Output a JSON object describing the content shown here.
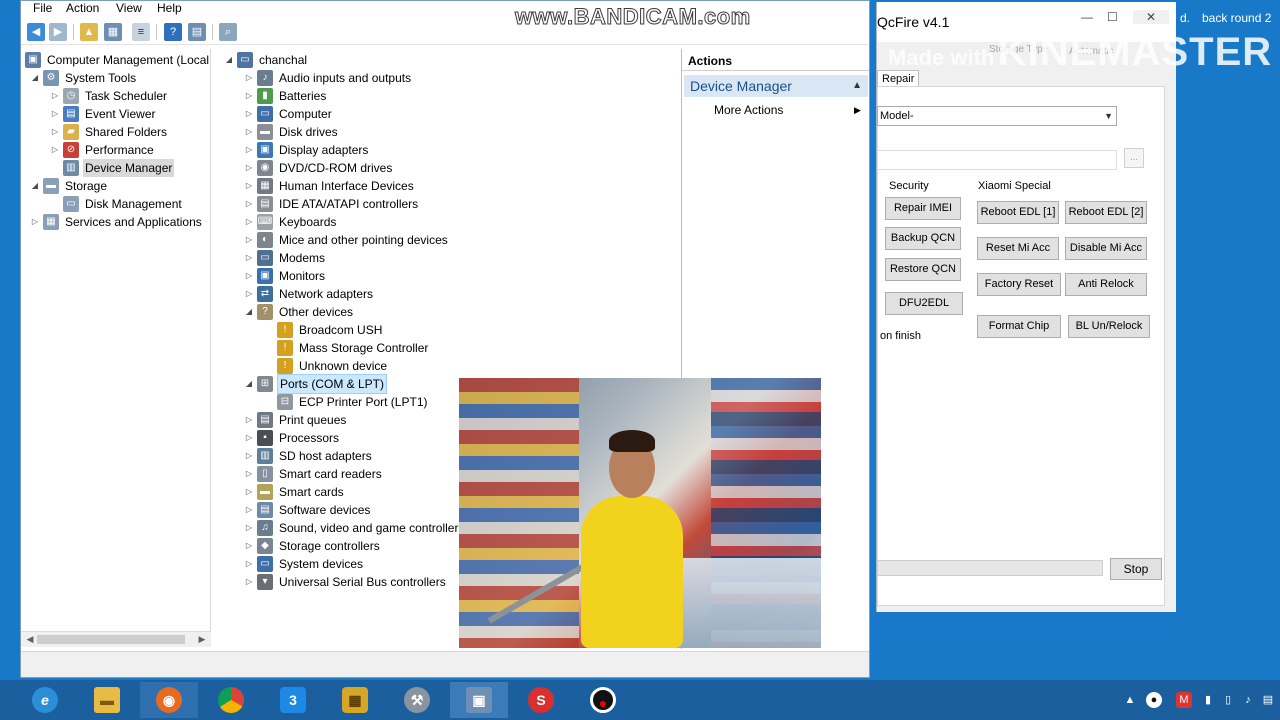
{
  "menubar": {
    "file": "File",
    "action": "Action",
    "view": "View",
    "help": "Help"
  },
  "left_tree": {
    "root": "Computer Management (Local",
    "system_tools": "System Tools",
    "task_scheduler": "Task Scheduler",
    "event_viewer": "Event Viewer",
    "shared_folders": "Shared Folders",
    "performance": "Performance",
    "device_manager": "Device Manager",
    "storage": "Storage",
    "disk_management": "Disk Management",
    "services": "Services and Applications"
  },
  "device_tree": {
    "root": "chanchal",
    "items": [
      "Audio inputs and outputs",
      "Batteries",
      "Computer",
      "Disk drives",
      "Display adapters",
      "DVD/CD-ROM drives",
      "Human Interface Devices",
      "IDE ATA/ATAPI controllers",
      "Keyboards",
      "Mice and other pointing devices",
      "Modems",
      "Monitors",
      "Network adapters",
      "Other devices",
      "Broadcom USH",
      "Mass Storage Controller",
      "Unknown device",
      "Ports (COM & LPT)",
      "ECP Printer Port (LPT1)",
      "Print queues",
      "Processors",
      "SD host adapters",
      "Smart card readers",
      "Smart cards",
      "Software devices",
      "Sound, video and game controllers",
      "Storage controllers",
      "System devices",
      "Universal Serial Bus controllers"
    ]
  },
  "actions": {
    "header": "Actions",
    "section": "Device Manager",
    "more": "More Actions"
  },
  "qcfire": {
    "title": "QcFire v4.1",
    "tab": "Repair",
    "model_select": "Model-",
    "storage_type": "Storage Type",
    "automatic": "Automatic",
    "security_label": "Security",
    "xiaomi_label": "Xiaomi Special",
    "btn_repair_imei": "Repair IMEI",
    "btn_backup_qcn": "Backup QCN",
    "btn_restore_qcn": "Restore QCN",
    "btn_dfu2edl": "DFU2EDL",
    "btn_reboot_edl1": "Reboot EDL [1]",
    "btn_reboot_edl2": "Reboot EDL [2]",
    "btn_reset_mi": "Reset Mi Acc",
    "btn_disable_mi": "Disable Mi Acc",
    "btn_factory_reset": "Factory Reset",
    "btn_anti_relock": "Anti Relock",
    "btn_format_chip": "Format Chip",
    "btn_bl_unrelock": "BL Un/Relock",
    "on_finish": "on finish",
    "btn_stop": "Stop"
  },
  "stray": {
    "top_right_1": "d.",
    "top_right_2": "back round 2"
  },
  "watermarks": {
    "bandicam": "www.BANDICAM.com",
    "kinemaster_small": "Made with",
    "kinemaster_large": "KINEMASTER"
  },
  "colors": {
    "desktop": "#1779c8",
    "taskbar": "#1c5f9e",
    "selection": "#cce8ff",
    "action_section": "#d9e7f5"
  }
}
